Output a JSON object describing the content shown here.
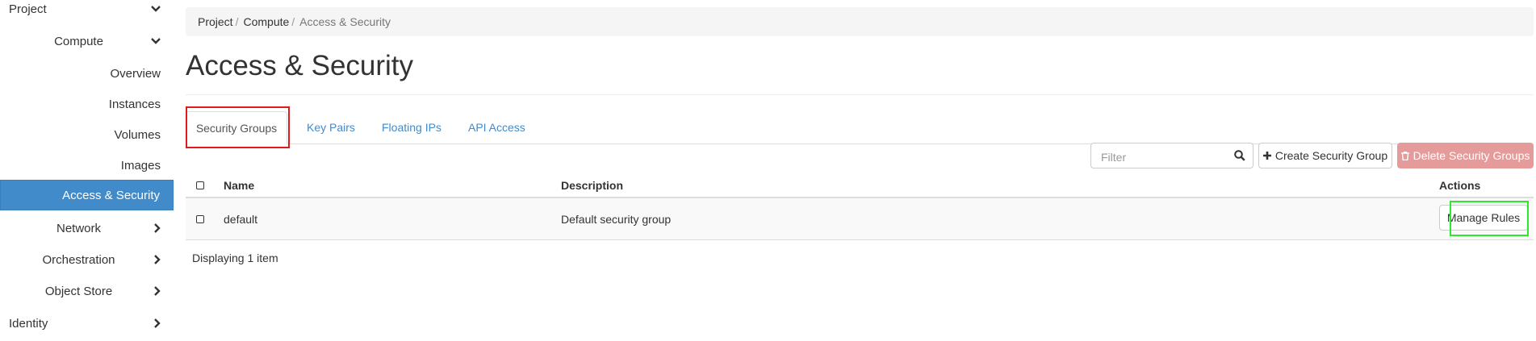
{
  "sidebar": {
    "project": "Project",
    "compute": "Compute",
    "items": [
      "Overview",
      "Instances",
      "Volumes",
      "Images",
      "Access & Security"
    ],
    "network": "Network",
    "orchestration": "Orchestration",
    "object_store": "Object Store",
    "identity": "Identity",
    "active_color": "#428bca"
  },
  "breadcrumb": [
    "Project",
    "Compute",
    "Access & Security"
  ],
  "page_title": "Access & Security",
  "tabs": [
    "Security Groups",
    "Key Pairs",
    "Floating IPs",
    "API Access"
  ],
  "actions": {
    "filter_placeholder": "Filter",
    "filter_icon": "search-icon",
    "create_label": "Create Security Group",
    "create_icon": "plus-icon",
    "delete_label": "Delete Security Groups",
    "delete_icon": "trash-icon"
  },
  "table": {
    "headers": [
      "Name",
      "Description",
      "Actions"
    ],
    "rows": [
      {
        "name": "default",
        "description": "Default security group",
        "action": "Manage Rules"
      }
    ],
    "count_text": "Displaying 1 item"
  },
  "colors": {
    "link": "#428bca",
    "danger": "#e69b9b",
    "highlight_red": "#e01b1b",
    "highlight_green": "#2ee82e"
  }
}
